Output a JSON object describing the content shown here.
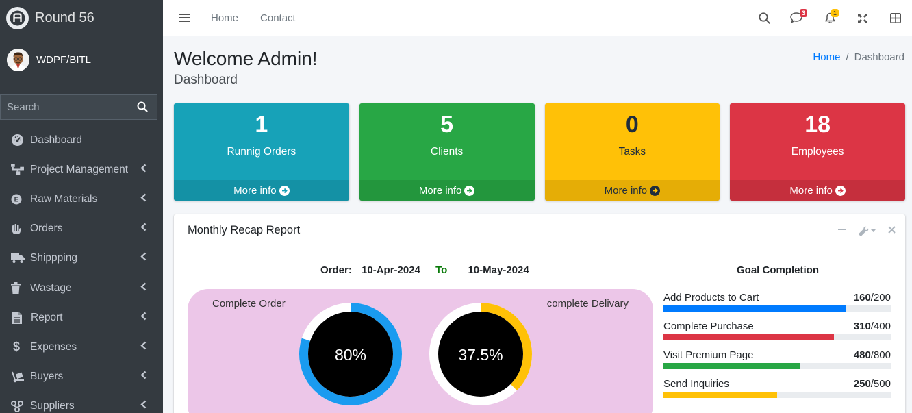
{
  "brand": {
    "name": "Round 56"
  },
  "user": {
    "name": "WDPF/BITL"
  },
  "search": {
    "placeholder": "Search"
  },
  "sidebar": {
    "items": [
      {
        "label": "Dashboard",
        "icon": "tachometer-icon",
        "has_children": false
      },
      {
        "label": "Project Management",
        "icon": "sitemap-icon",
        "has_children": true
      },
      {
        "label": "Raw Materials",
        "icon": "e-circle-icon",
        "has_children": true
      },
      {
        "label": "Orders",
        "icon": "hand-holding-icon",
        "has_children": true
      },
      {
        "label": "Shippping",
        "icon": "truck-icon",
        "has_children": true
      },
      {
        "label": "Wastage",
        "icon": "trash-icon",
        "has_children": true
      },
      {
        "label": "Report",
        "icon": "file-icon",
        "has_children": true
      },
      {
        "label": "Expenses",
        "icon": "dollar-icon",
        "has_children": true
      },
      {
        "label": "Buyers",
        "icon": "dolly-icon",
        "has_children": true
      },
      {
        "label": "Suppliers",
        "icon": "network-icon",
        "has_children": true
      }
    ]
  },
  "topnav": {
    "links": [
      "Home",
      "Contact"
    ],
    "messages_badge": "3",
    "notifications_badge": "1"
  },
  "header": {
    "title": "Welcome Admin!",
    "subtitle": "Dashboard"
  },
  "breadcrumb": {
    "home": "Home",
    "separator": "/",
    "current": "Dashboard"
  },
  "boxes": [
    {
      "value": "1",
      "label": "Runnig Orders",
      "more": "More info",
      "color": "#17a2b8",
      "text_color": "#ffffff"
    },
    {
      "value": "5",
      "label": "Clients",
      "more": "More info",
      "color": "#28a745",
      "text_color": "#ffffff"
    },
    {
      "value": "0",
      "label": "Tasks",
      "more": "More info",
      "color": "#ffc107",
      "text_color": "#1f2d3d"
    },
    {
      "value": "18",
      "label": "Employees",
      "more": "More info",
      "color": "#dc3545",
      "text_color": "#ffffff"
    }
  ],
  "report": {
    "title": "Monthly Recap Report",
    "order_label": "Order:",
    "from_date": "10-Apr-2024",
    "to_label": "To",
    "to_date": "10-May-2024",
    "complete_order_label": "Complete Order",
    "complete_delivery_label": "complete Delivary",
    "order_pct_text": "80%",
    "order_pct": 80,
    "order_color": "#1a9bf0",
    "delivery_pct_text": "37.5%",
    "delivery_pct": 37.5,
    "delivery_color": "#ffc107"
  },
  "goals": {
    "title": "Goal Completion",
    "items": [
      {
        "label": "Add Products to Cart",
        "done": "160",
        "total": "/200",
        "fraction": 0.8,
        "color": "#007bff"
      },
      {
        "label": "Complete Purchase",
        "done": "310",
        "total": "/400",
        "fraction": 0.75,
        "color": "#dc3545"
      },
      {
        "label": "Visit Premium Page",
        "done": "480",
        "total": "/800",
        "fraction": 0.6,
        "color": "#28a745"
      },
      {
        "label": "Send Inquiries",
        "done": "250",
        "total": "/500",
        "fraction": 0.5,
        "color": "#ffc107"
      }
    ]
  }
}
